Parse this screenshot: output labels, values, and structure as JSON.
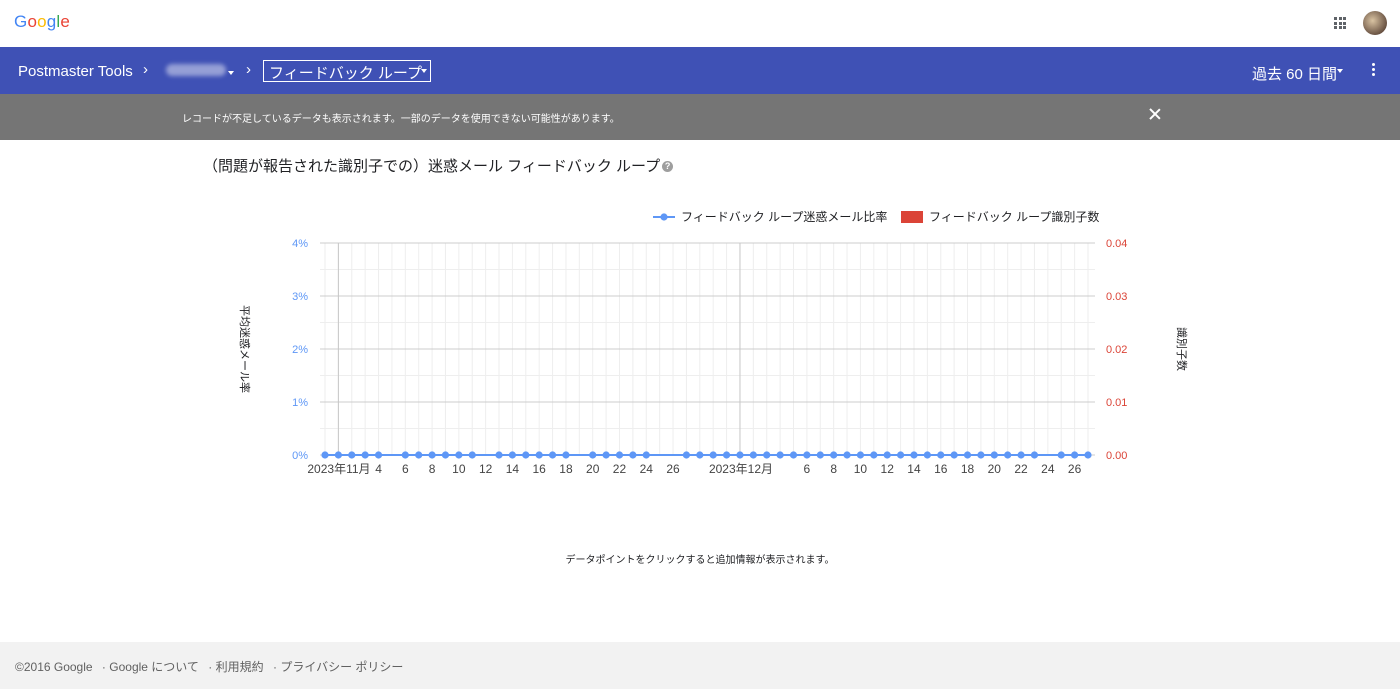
{
  "google_bar": {
    "logo": [
      "G",
      "o",
      "o",
      "g",
      "l",
      "e"
    ],
    "logo_colors": [
      "#4285f4",
      "#ea4335",
      "#fbbc05",
      "#4285f4",
      "#34a853",
      "#ea4335"
    ]
  },
  "header": {
    "app_title": "Postmaster Tools",
    "section": "フィードバック ループ",
    "date_range": "過去 60 日間"
  },
  "notice": {
    "text": "レコードが不足しているデータも表示されます。一部のデータを使用できない可能性があります。"
  },
  "chart": {
    "title": "（問題が報告された識別子での）迷惑メール フィードバック ループ",
    "hint": "データポイントをクリックすると追加情報が表示されます。"
  },
  "chart_data": {
    "type": "line",
    "series": [
      {
        "name": "フィードバック ループ迷惑メール比率",
        "color": "#5e97f6",
        "axis": "left",
        "values": [
          0,
          0,
          0,
          0,
          0,
          null,
          0,
          0,
          0,
          0,
          0,
          0,
          null,
          0,
          0,
          0,
          0,
          0,
          0,
          null,
          0,
          0,
          0,
          0,
          0,
          null,
          null,
          0,
          0,
          0,
          0,
          0,
          0,
          0,
          0,
          0,
          0,
          0,
          0,
          0,
          0,
          0,
          0,
          0,
          0,
          0,
          0,
          0,
          0,
          0,
          0,
          0,
          0,
          0,
          null,
          0,
          0,
          0
        ]
      },
      {
        "name": "フィードバック ループ識別子数",
        "color": "#db4437",
        "axis": "right",
        "values": []
      }
    ],
    "x_start": "2023-10-31",
    "x_points": 58,
    "x_ticks": [
      {
        "label": "2023年11月",
        "day": 1
      },
      {
        "label": "4",
        "day": 4
      },
      {
        "label": "6",
        "day": 6
      },
      {
        "label": "8",
        "day": 8
      },
      {
        "label": "10",
        "day": 10
      },
      {
        "label": "12",
        "day": 12
      },
      {
        "label": "14",
        "day": 14
      },
      {
        "label": "16",
        "day": 16
      },
      {
        "label": "18",
        "day": 18
      },
      {
        "label": "20",
        "day": 20
      },
      {
        "label": "22",
        "day": 22
      },
      {
        "label": "24",
        "day": 24
      },
      {
        "label": "26",
        "day": 26
      },
      {
        "label": "2023年12月",
        "day": 31
      },
      {
        "label": "6",
        "day": 36
      },
      {
        "label": "8",
        "day": 38
      },
      {
        "label": "10",
        "day": 40
      },
      {
        "label": "12",
        "day": 42
      },
      {
        "label": "14",
        "day": 44
      },
      {
        "label": "16",
        "day": 46
      },
      {
        "label": "18",
        "day": 48
      },
      {
        "label": "20",
        "day": 50
      },
      {
        "label": "22",
        "day": 52
      },
      {
        "label": "24",
        "day": 54
      },
      {
        "label": "26",
        "day": 56
      }
    ],
    "y_left": {
      "label": "平均迷惑メール率",
      "ticks": [
        "0%",
        "1%",
        "2%",
        "3%",
        "4%"
      ],
      "ylim": [
        0,
        0.04
      ]
    },
    "y_right": {
      "label": "識別子数",
      "ticks": [
        "0.00",
        "0.01",
        "0.02",
        "0.03",
        "0.04"
      ],
      "ylim": [
        0,
        0.04
      ]
    },
    "legend_position": "top-right",
    "grid": true
  },
  "footer": {
    "copyright": "©2016 Google",
    "links": [
      "Google について",
      "利用規約",
      "プライバシー ポリシー"
    ]
  }
}
